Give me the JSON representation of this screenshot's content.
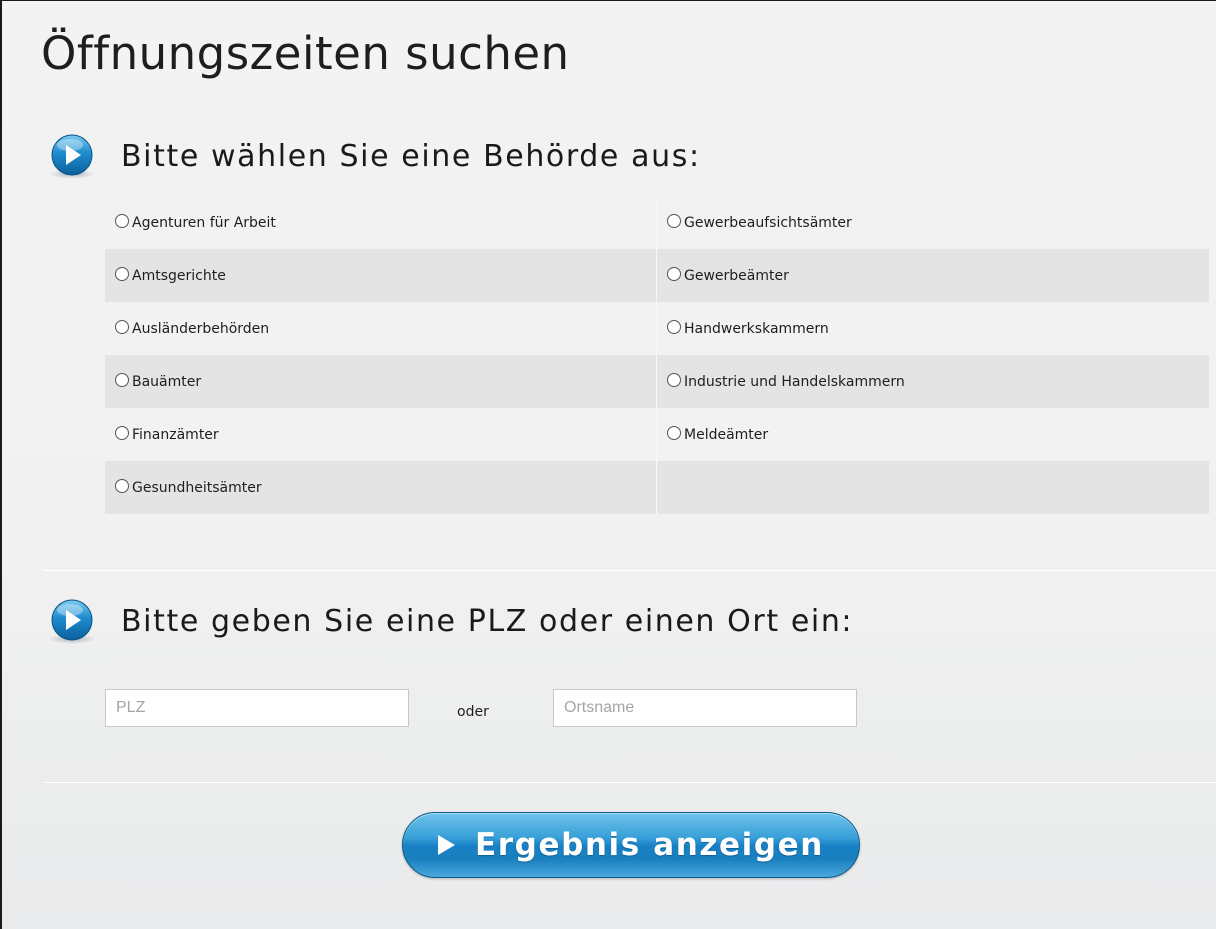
{
  "page_title": "Öffnungszeiten suchen",
  "colors": {
    "accent_blue": "#1b86c8",
    "row_dark": "#e4e4e4",
    "row_light": "#f2f2f2"
  },
  "section_agency": {
    "icon": "play-circle-icon",
    "title": "Bitte wählen Sie eine Behörde aus:",
    "options_left": [
      "Agenturen für Arbeit",
      "Amtsgerichte",
      "Ausländerbehörden",
      "Bauämter",
      "Finanzämter",
      "Gesundheitsämter"
    ],
    "options_right": [
      "Gewerbeaufsichtsämter",
      "Gewerbeämter",
      "Handwerkskammern",
      "Industrie und Handelskammern",
      "Meldeämter"
    ]
  },
  "section_location": {
    "icon": "play-circle-icon",
    "title": "Bitte geben Sie eine PLZ oder einen Ort ein:",
    "plz": {
      "placeholder": "PLZ",
      "value": ""
    },
    "separator": "oder",
    "ort": {
      "placeholder": "Ortsname",
      "value": ""
    }
  },
  "submit": {
    "icon": "play-arrow-icon",
    "label": "Ergebnis anzeigen"
  }
}
